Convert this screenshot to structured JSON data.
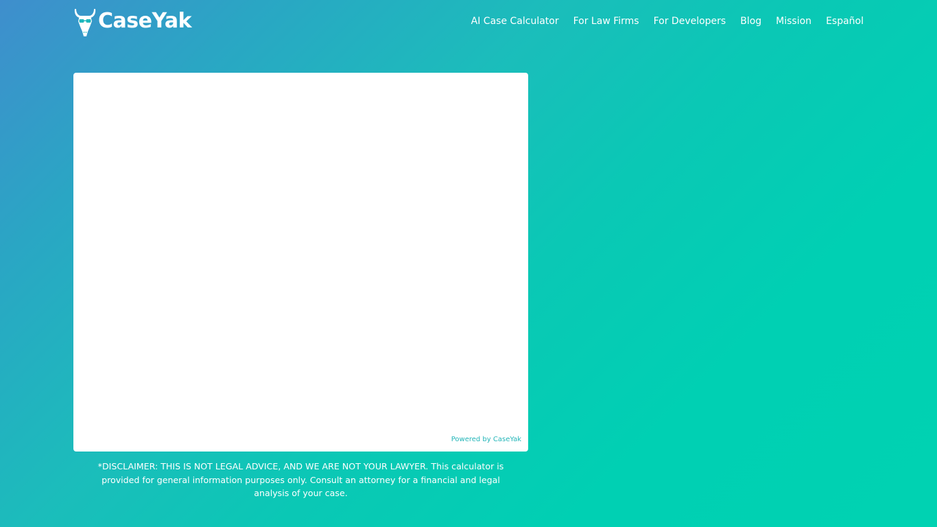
{
  "brand": {
    "name": "CaseYak",
    "logo_icon": "yak-with-glasses-icon"
  },
  "nav": {
    "items": [
      {
        "label": "AI Case Calculator"
      },
      {
        "label": "For Law Firms"
      },
      {
        "label": "For Developers"
      },
      {
        "label": "Blog"
      },
      {
        "label": "Mission"
      },
      {
        "label": "Español"
      }
    ]
  },
  "calculator": {
    "powered_by": "Powered by CaseYak"
  },
  "disclaimer": {
    "text": "*DISCLAIMER: THIS IS NOT LEGAL ADVICE, AND WE ARE NOT YOUR LAWYER. This calculator is provided for general information purposes only. Consult an attorney for a financial and legal analysis of your case."
  },
  "colors": {
    "gradient_start": "#3f8ecd",
    "gradient_end": "#00d2b2",
    "accent": "#22b5b8",
    "card_bg": "#ffffff"
  }
}
